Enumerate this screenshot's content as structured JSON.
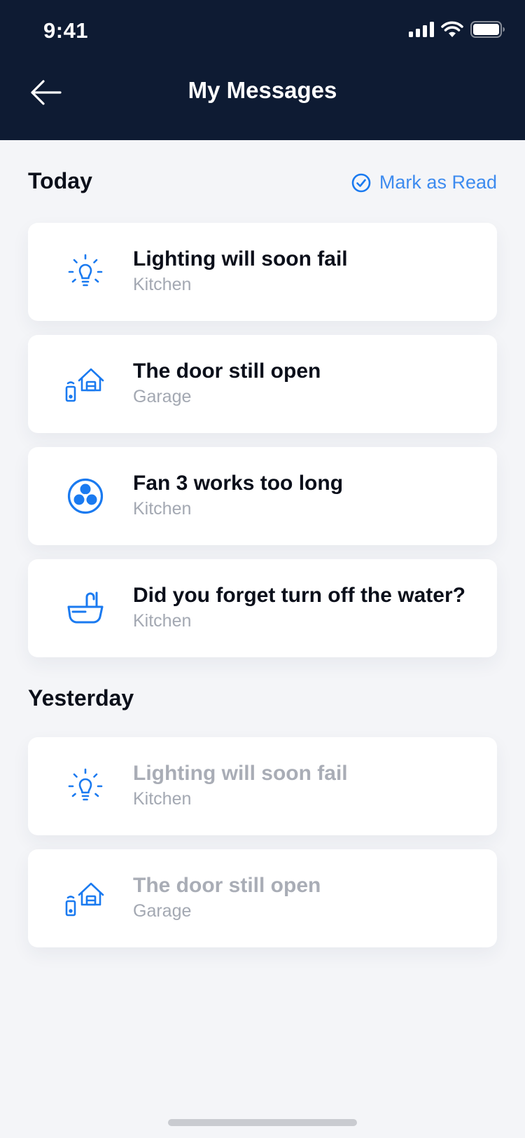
{
  "status_bar": {
    "time": "9:41"
  },
  "header": {
    "title": "My Messages"
  },
  "today": {
    "label": "Today",
    "mark_read_label": "Mark as Read",
    "items": [
      {
        "title": "Lighting will soon fail",
        "subtitle": "Kitchen",
        "icon": "lightbulb-icon"
      },
      {
        "title": "The door still open",
        "subtitle": "Garage",
        "icon": "garage-remote-icon"
      },
      {
        "title": "Fan 3 works too long",
        "subtitle": "Kitchen",
        "icon": "fan-icon"
      },
      {
        "title": "Did you forget turn off the water?",
        "subtitle": "Kitchen",
        "icon": "bathtub-icon"
      }
    ]
  },
  "yesterday": {
    "label": "Yesterday",
    "items": [
      {
        "title": "Lighting will soon fail",
        "subtitle": "Kitchen",
        "icon": "lightbulb-icon"
      },
      {
        "title": "The door still open",
        "subtitle": "Garage",
        "icon": "garage-remote-icon"
      }
    ]
  },
  "colors": {
    "header_bg": "#0E1B33",
    "accent": "#1A7AF0",
    "background": "#F4F5F8",
    "muted_text": "#A3A8B2"
  }
}
